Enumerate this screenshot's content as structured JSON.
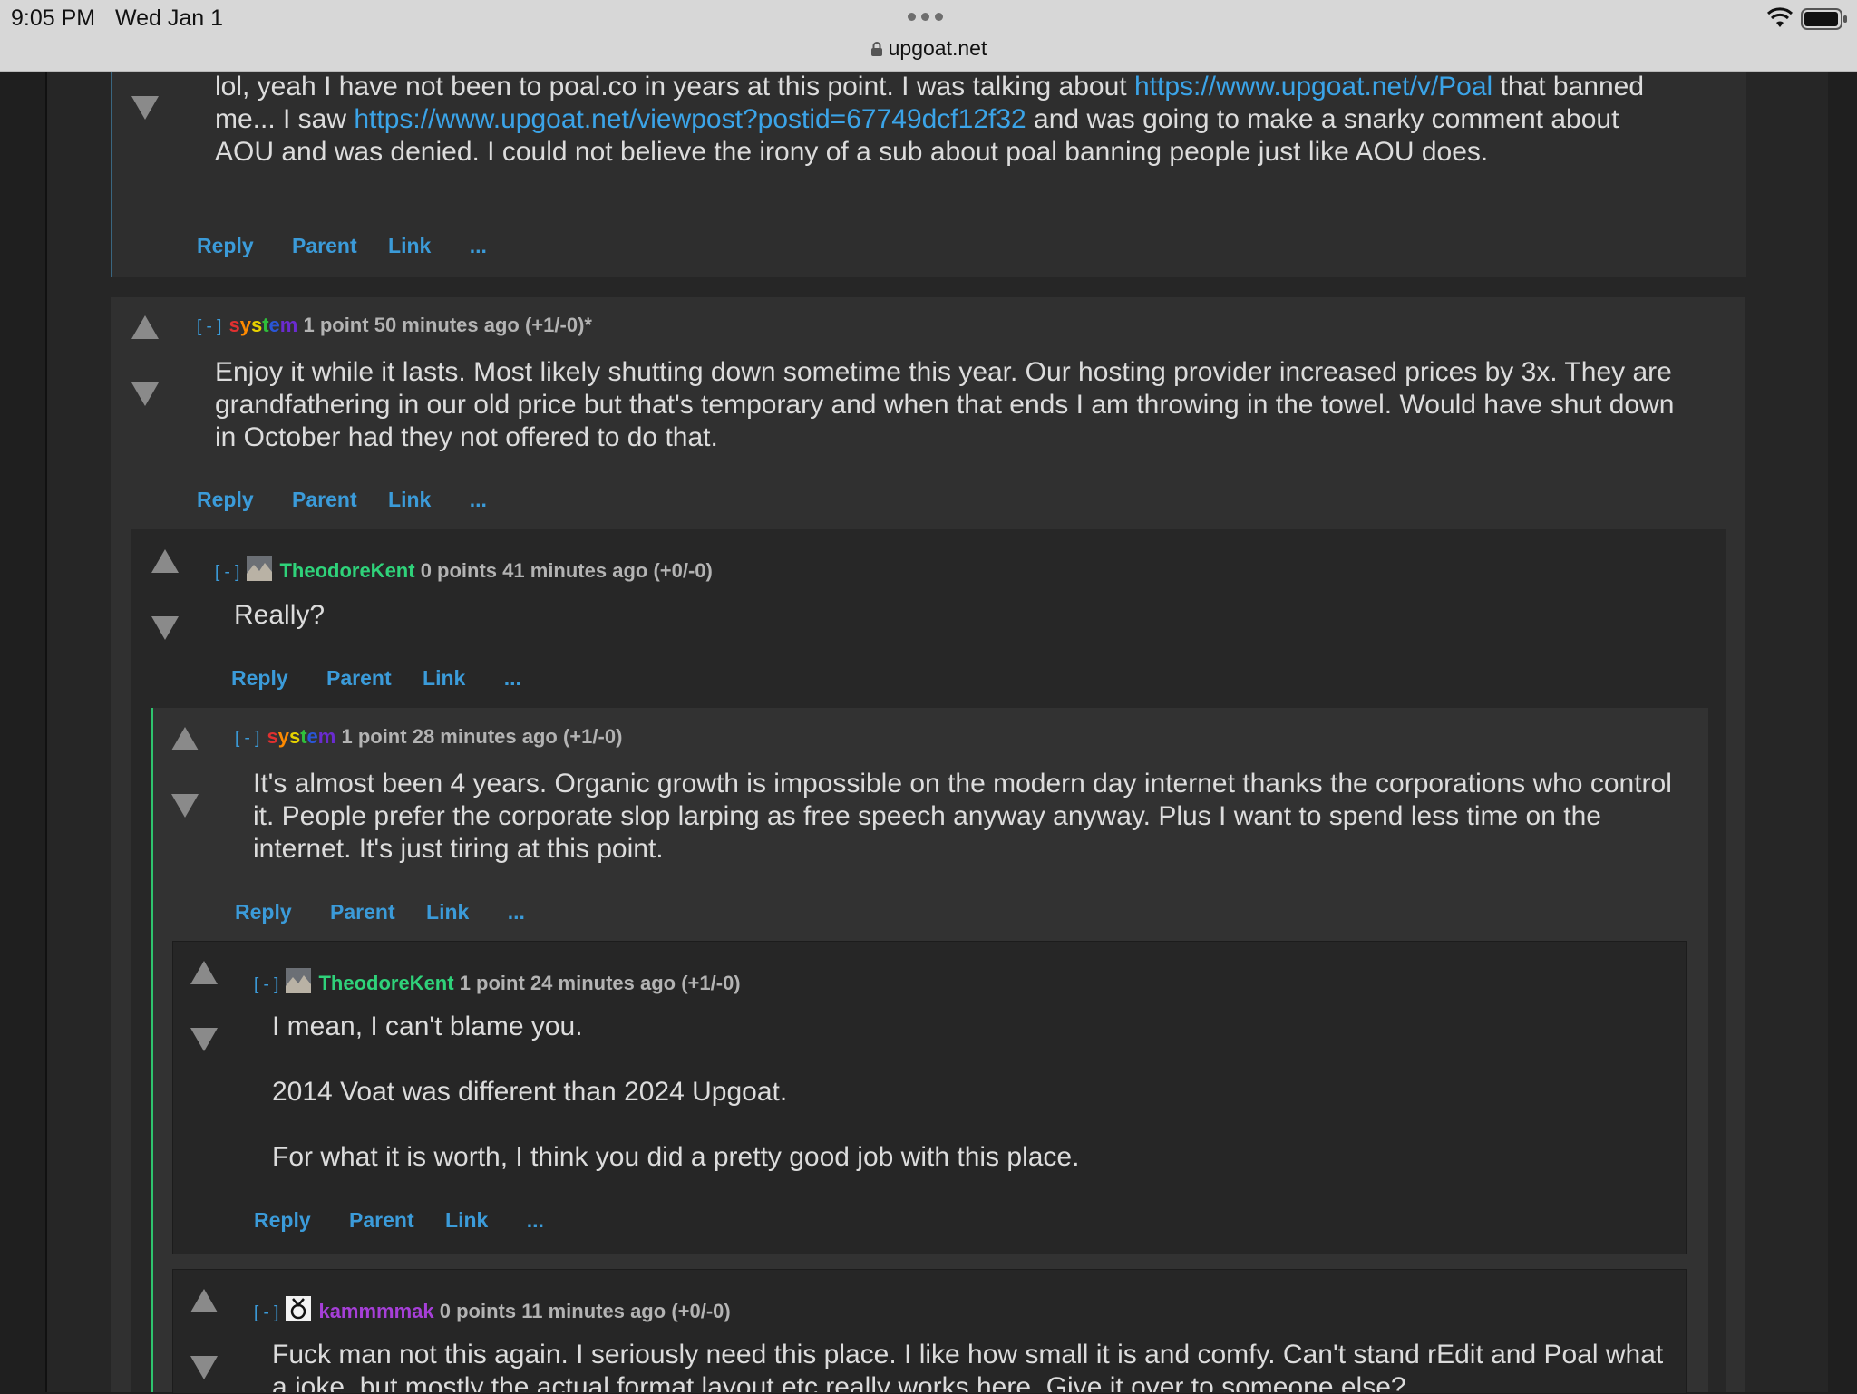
{
  "status_bar": {
    "time": "9:05 PM",
    "date": "Wed Jan 1",
    "url": "upgoat.net"
  },
  "actions": {
    "reply": "Reply",
    "parent": "Parent",
    "link": "Link",
    "more": "..."
  },
  "collapse_label": "[ - ]",
  "comments": [
    {
      "body": {
        "t1": "lol, yeah I have not been to poal.co in years at this point. I was talking about ",
        "link1": "https://www.upgoat.net/v/Poal",
        "t2": " that banned me... I saw ",
        "link2": "https://www.upgoat.net/viewpost?postid=67749dcf12f32",
        "t3": " and was going to make a snarky comment about AOU and was denied. I could not believe the irony of a sub about poal banning people just like AOU does."
      }
    },
    {
      "username": "system",
      "score": "1 point",
      "age": "50 minutes ago",
      "votes": "(+1/-0)*",
      "body": "Enjoy it while it lasts. Most likely shutting down sometime this year. Our hosting provider increased prices by 3x. They are grandfathering in our old price but that's temporary and when that ends I am throwing in the towel. Would have shut down in October had they not offered to do that."
    },
    {
      "username": "TheodoreKent",
      "score": "0 points",
      "age": "41 minutes ago",
      "votes": "(+0/-0)",
      "body": "Really?"
    },
    {
      "username": "system",
      "score": "1 point",
      "age": "28 minutes ago",
      "votes": "(+1/-0)",
      "body": "It's almost been 4 years. Organic growth is impossible on the modern day internet thanks the corporations who control it. People prefer the corporate slop larping as free speech anyway anyway. Plus I want to spend less time on the internet. It's just tiring at this point."
    },
    {
      "username": "TheodoreKent",
      "score": "1 point",
      "age": "24 minutes ago",
      "votes": "(+1/-0)",
      "body": [
        "I mean, I can't blame you.",
        "2014 Voat was different than 2024 Upgoat.",
        "For what it is worth, I think you did a pretty good job with this place."
      ]
    },
    {
      "username": "kammmmak",
      "score": "0 points",
      "age": "11 minutes ago",
      "votes": "(+0/-0)",
      "body": "Fuck man not this again. I seriously need this place. I like how small it is and comfy. Can't stand rEdit and Poal what a joke, but mostly the actual format layout etc really works here. Give it over to someone else?"
    }
  ]
}
